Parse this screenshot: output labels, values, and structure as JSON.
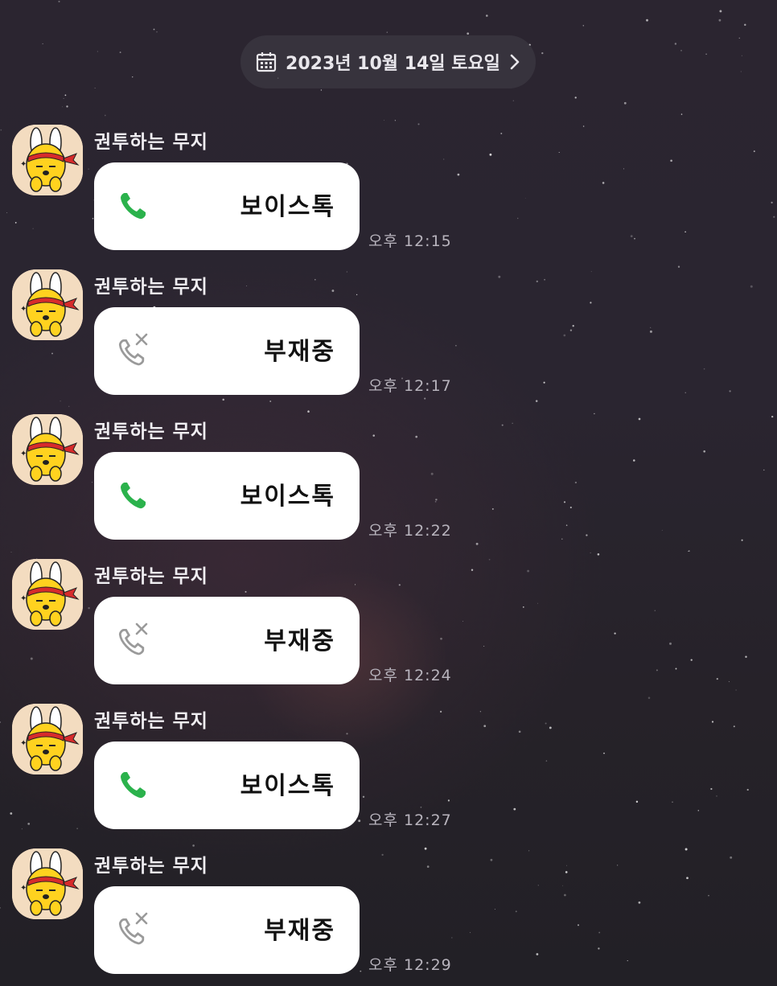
{
  "header": {
    "date_label": "2023년 10월 14일 토요일",
    "calendar_icon": "calendar-icon",
    "chevron_icon": "chevron-right-icon"
  },
  "colors": {
    "call_green": "#2bb24c",
    "missed_gray": "#9a9a9a",
    "bubble_bg": "#ffffff"
  },
  "messages": [
    {
      "sender": "권투하는 무지",
      "avatar": "muzi-boxing-avatar",
      "type": "voice",
      "icon": "phone-icon",
      "label": "보이스톡",
      "time": "오후 12:15"
    },
    {
      "sender": "권투하는 무지",
      "avatar": "muzi-boxing-avatar",
      "type": "missed",
      "icon": "missed-call-icon",
      "label": "부재중",
      "time": "오후 12:17"
    },
    {
      "sender": "권투하는 무지",
      "avatar": "muzi-boxing-avatar",
      "type": "voice",
      "icon": "phone-icon",
      "label": "보이스톡",
      "time": "오후 12:22"
    },
    {
      "sender": "권투하는 무지",
      "avatar": "muzi-boxing-avatar",
      "type": "missed",
      "icon": "missed-call-icon",
      "label": "부재중",
      "time": "오후 12:24"
    },
    {
      "sender": "권투하는 무지",
      "avatar": "muzi-boxing-avatar",
      "type": "voice",
      "icon": "phone-icon",
      "label": "보이스톡",
      "time": "오후 12:27"
    },
    {
      "sender": "권투하는 무지",
      "avatar": "muzi-boxing-avatar",
      "type": "missed",
      "icon": "missed-call-icon",
      "label": "부재중",
      "time": "오후 12:29"
    }
  ]
}
